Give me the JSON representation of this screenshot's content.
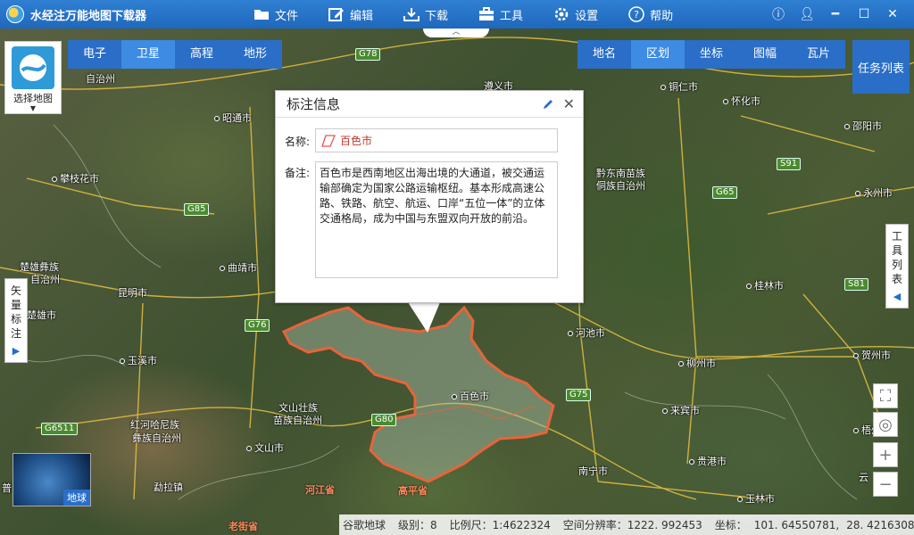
{
  "app": {
    "title": "水经注万能地图下载器"
  },
  "menu": [
    {
      "label": "文件",
      "icon": "folder-icon"
    },
    {
      "label": "编辑",
      "icon": "edit-icon"
    },
    {
      "label": "下载",
      "icon": "download-icon"
    },
    {
      "label": "工具",
      "icon": "toolbox-icon"
    },
    {
      "label": "设置",
      "icon": "gear-icon"
    },
    {
      "label": "帮助",
      "icon": "help-icon"
    }
  ],
  "window_controls": [
    "info",
    "user",
    "minimize",
    "maximize",
    "close"
  ],
  "map_selector": {
    "label": "选择地图"
  },
  "layer_tabs": {
    "items": [
      "电子",
      "卫星",
      "高程",
      "地形"
    ],
    "active": "卫星"
  },
  "right_tabs": {
    "items": [
      "地名",
      "区划",
      "坐标",
      "图幅",
      "瓦片"
    ],
    "active": "区划"
  },
  "task_list": {
    "label": "任务列表"
  },
  "side_tabs": {
    "left": {
      "label": "矢量标注"
    },
    "right": {
      "label": "工具列表"
    }
  },
  "popup": {
    "title": "标注信息",
    "name_label": "名称:",
    "name_value": "百色市",
    "note_label": "备注:",
    "note_value": "百色市是西南地区出海出境的大通道，被交通运输部确定为国家公路运输枢纽。基本形成高速公路、铁路、航空、航运、口岸“五位一体”的立体交通格局，成为中国与东盟双向开放的前沿。"
  },
  "globe": {
    "label": "地球"
  },
  "places": {
    "zunyi": "遵义市",
    "tongren": "铜仁市",
    "huaihua": "怀化市",
    "shaoyang": "邵阳市",
    "zhaotong": "昭通市",
    "panzhihua": "攀枝花市",
    "qiandongnan": "黔东南苗族",
    "qiandongnan2": "侗族自治州",
    "yongzhou": "永州市",
    "qujing": "曲靖市",
    "chuxiong": "楚雄彝族",
    "chuxiong2": "自治州",
    "chuxiong3": "楚雄市",
    "kunming": "昆明市",
    "guilin": "桂林市",
    "hechi": "河池市",
    "yuxi": "玉溪市",
    "liuzhou": "柳州市",
    "hezhou": "贺州市",
    "wenshan": "文山壮族",
    "wenshan2": "苗族自治州",
    "wenshancity": "文山市",
    "baise": "百色市",
    "laibin": "来宾市",
    "honghe": "红河哈尼族",
    "honghe2": "彝族自治州",
    "wuzhou": "梧州市",
    "guigang": "贵港市",
    "mengzi": "勐拉镇",
    "nanning": "南宁市",
    "yulin": "玉林市",
    "zizhizhou": "自治州",
    "hejiang": "河江省",
    "gaoping": "高平省",
    "laojie": "老街省",
    "yun": "云",
    "pu": "普"
  },
  "highways": [
    "G78",
    "G85",
    "G76",
    "G80",
    "G75",
    "G65",
    "S91",
    "S81",
    "G6511",
    "G78"
  ],
  "status": {
    "source": "谷歌地球",
    "level_label": "级别：8",
    "scale_label": "比例尺：1:4622324",
    "resolution_label": "空间分辨率：1222. 992453",
    "coord_label": "坐标：",
    "lon": "101. 64550781,",
    "lat": "28. 42163086"
  },
  "colors": {
    "titlebar": "#2174c8",
    "tab": "#2a6ec7",
    "tab_active": "#3d8be3",
    "boundary": "#e8643a"
  }
}
